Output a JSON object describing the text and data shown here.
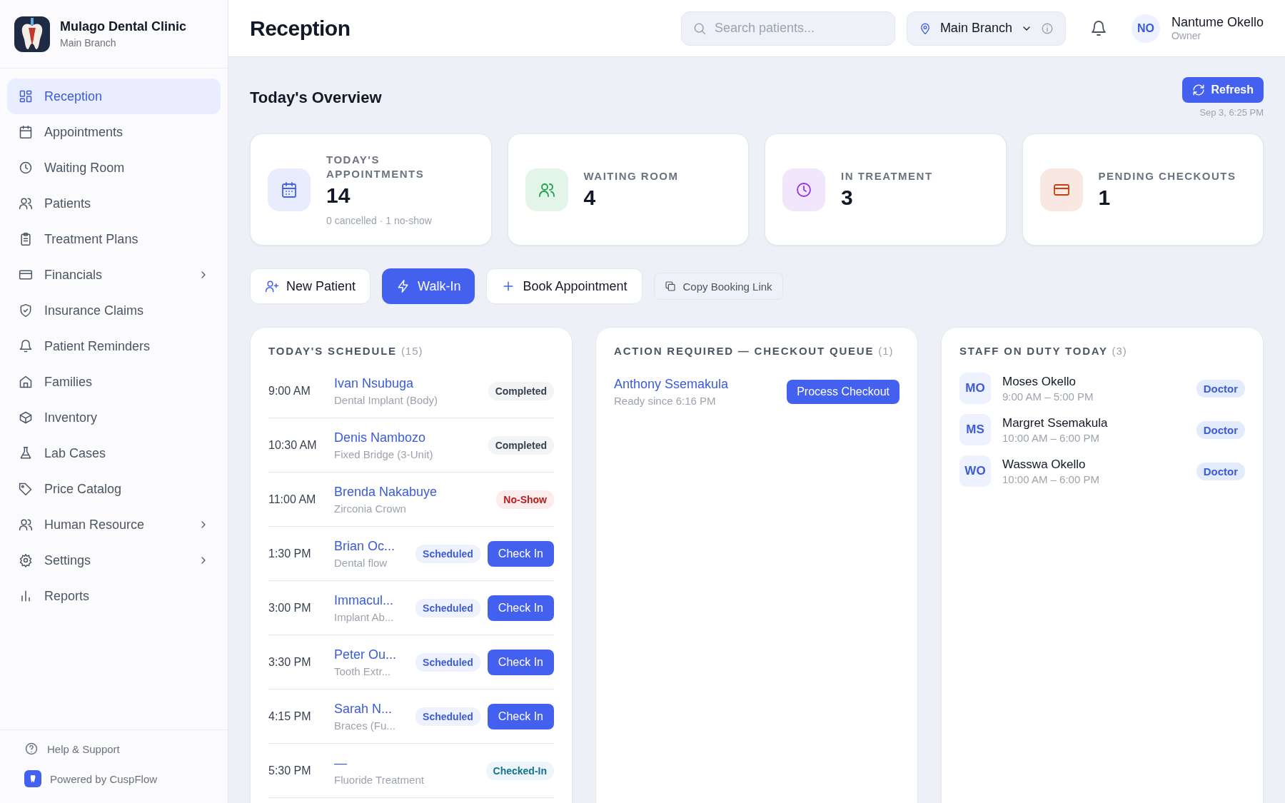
{
  "clinic": {
    "name": "Mulago Dental Clinic",
    "branch": "Main Branch"
  },
  "nav": [
    {
      "label": "Reception",
      "selected": true,
      "expandable": false
    },
    {
      "label": "Appointments",
      "selected": false,
      "expandable": false
    },
    {
      "label": "Waiting Room",
      "selected": false,
      "expandable": false
    },
    {
      "label": "Patients",
      "selected": false,
      "expandable": false
    },
    {
      "label": "Treatment Plans",
      "selected": false,
      "expandable": false
    },
    {
      "label": "Financials",
      "selected": false,
      "expandable": true
    },
    {
      "label": "Insurance Claims",
      "selected": false,
      "expandable": false
    },
    {
      "label": "Patient Reminders",
      "selected": false,
      "expandable": false
    },
    {
      "label": "Families",
      "selected": false,
      "expandable": false
    },
    {
      "label": "Inventory",
      "selected": false,
      "expandable": false
    },
    {
      "label": "Lab Cases",
      "selected": false,
      "expandable": false
    },
    {
      "label": "Price Catalog",
      "selected": false,
      "expandable": false
    },
    {
      "label": "Human Resource",
      "selected": false,
      "expandable": true
    },
    {
      "label": "Settings",
      "selected": false,
      "expandable": true
    },
    {
      "label": "Reports",
      "selected": false,
      "expandable": false
    }
  ],
  "sidebar_footer": {
    "help": "Help & Support",
    "powered_by": "Powered by CuspFlow"
  },
  "header": {
    "title": "Reception",
    "search": {
      "placeholder": "Search patients..."
    },
    "branch": "Main Branch",
    "user": {
      "initials": "NO",
      "name": "Nantume Okello",
      "role": "Owner"
    }
  },
  "overview": {
    "title": "Today's Overview",
    "refresh": "Refresh",
    "updated": "Sep 3, 6:25 PM"
  },
  "stats": [
    {
      "label": "TODAY'S APPOINTMENTS",
      "value": "14",
      "note": "0 cancelled · 1 no-show",
      "color": "#4361ee"
    },
    {
      "label": "WAITING ROOM",
      "value": "4",
      "color": "#16a34a"
    },
    {
      "label": "IN TREATMENT",
      "value": "3",
      "color": "#9333ea"
    },
    {
      "label": "PENDING CHECKOUTS",
      "value": "1",
      "color": "#c2410c"
    }
  ],
  "actions": [
    {
      "kind": "outline",
      "label": "New Patient"
    },
    {
      "kind": "primary",
      "label": "Walk-In"
    },
    {
      "kind": "outline",
      "label": "Book Appointment"
    },
    {
      "kind": "subtle",
      "label": "Copy Booking Link"
    }
  ],
  "schedule": {
    "title": "TODAY'S SCHEDULE",
    "count": "(15)",
    "rows": [
      {
        "time": "9:00 AM",
        "patient": "Ivan Nsubuga",
        "procedure": "Dental Implant (Body)",
        "status": "Completed",
        "kind": "completed"
      },
      {
        "time": "10:30 AM",
        "patient": "Denis Nambozo",
        "procedure": "Fixed Bridge (3-Unit)",
        "status": "Completed",
        "kind": "completed"
      },
      {
        "time": "11:00 AM",
        "patient": "Brenda Nakabuye",
        "procedure": "Zirconia Crown",
        "status": "No-Show",
        "kind": "no_show"
      },
      {
        "time": "1:30 PM",
        "patient": "Brian Oc...",
        "procedure": "Dental flow",
        "status": "Scheduled",
        "kind": "scheduled",
        "action": "Check In"
      },
      {
        "time": "3:00 PM",
        "patient": "Immacul...",
        "procedure": "Implant Ab...",
        "status": "Scheduled",
        "kind": "scheduled",
        "action": "Check In"
      },
      {
        "time": "3:30 PM",
        "patient": "Peter Ou...",
        "procedure": "Tooth Extr...",
        "status": "Scheduled",
        "kind": "scheduled",
        "action": "Check In"
      },
      {
        "time": "4:15 PM",
        "patient": "Sarah N...",
        "procedure": "Braces (Fu...",
        "status": "Scheduled",
        "kind": "scheduled",
        "action": "Check In"
      },
      {
        "time": "5:30 PM",
        "patient": "—",
        "procedure": "Fluoride Treatment",
        "status": "Checked-In",
        "kind": "checked_in"
      }
    ]
  },
  "checkout": {
    "title": "ACTION REQUIRED — CHECKOUT QUEUE",
    "count": "(1)",
    "items": [
      {
        "patient": "Anthony Ssemakula",
        "since": "Ready since 6:16 PM",
        "action": "Process Checkout"
      }
    ]
  },
  "staff": {
    "title": "STAFF ON DUTY TODAY",
    "count": "(3)",
    "members": [
      {
        "initials": "MO",
        "name": "Moses Okello",
        "hours": "9:00 AM – 5:00 PM",
        "role": "Doctor"
      },
      {
        "initials": "MS",
        "name": "Margret Ssemakula",
        "hours": "10:00 AM – 6:00 PM",
        "role": "Doctor"
      },
      {
        "initials": "WO",
        "name": "Wasswa Okello",
        "hours": "10:00 AM – 6:00 PM",
        "role": "Doctor"
      }
    ]
  }
}
